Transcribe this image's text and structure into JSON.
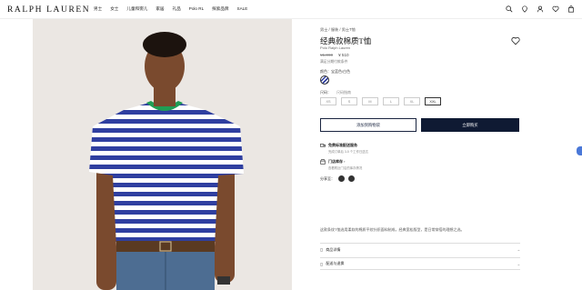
{
  "header": {
    "logo": "RALPH LAUREN",
    "nav": [
      "男士",
      "女士",
      "儿童和婴儿",
      "家居",
      "礼品",
      "Polo RL",
      "探索品牌",
      "SALE"
    ],
    "icons": [
      "search-icon",
      "store-locator-icon",
      "account-icon",
      "wishlist-icon",
      "bag-icon"
    ]
  },
  "product": {
    "breadcrumb": "男士 / 服装 / 男士T恤",
    "title": "经典款棉质T恤",
    "brand": "Polo Ralph Lauren",
    "price_old": "¥1,090",
    "price_new": "¥ 510",
    "installment": "满足分期付款条件",
    "color_label": "颜色：",
    "color_value": "宝蓝色/白色",
    "size_label": "尺码：",
    "size_guide": "尺码指南",
    "sizes": [
      "XS",
      "S",
      "M",
      "L",
      "XL",
      "XXL"
    ],
    "selected_size": "XXL",
    "add_wishlist": "添加到购物袋",
    "buy_now": "立即购买",
    "shipping_title": "免费标准配送服务",
    "shipping_sub": "完成订单后 3-5 个工作日送达",
    "store_title": "门店库存",
    "store_sub": "查看附近门店的库存情况",
    "share_label": "分享至：",
    "description": "这款条纹T恤选用柔软的棉质平纹针织面料制成，经典宽松版型，是日常穿搭的理想之选。",
    "accordion": [
      "商品详情",
      "配送与退换"
    ]
  },
  "colors": {
    "accent": "#0f1a33",
    "stripe": "#2f3fa0"
  }
}
